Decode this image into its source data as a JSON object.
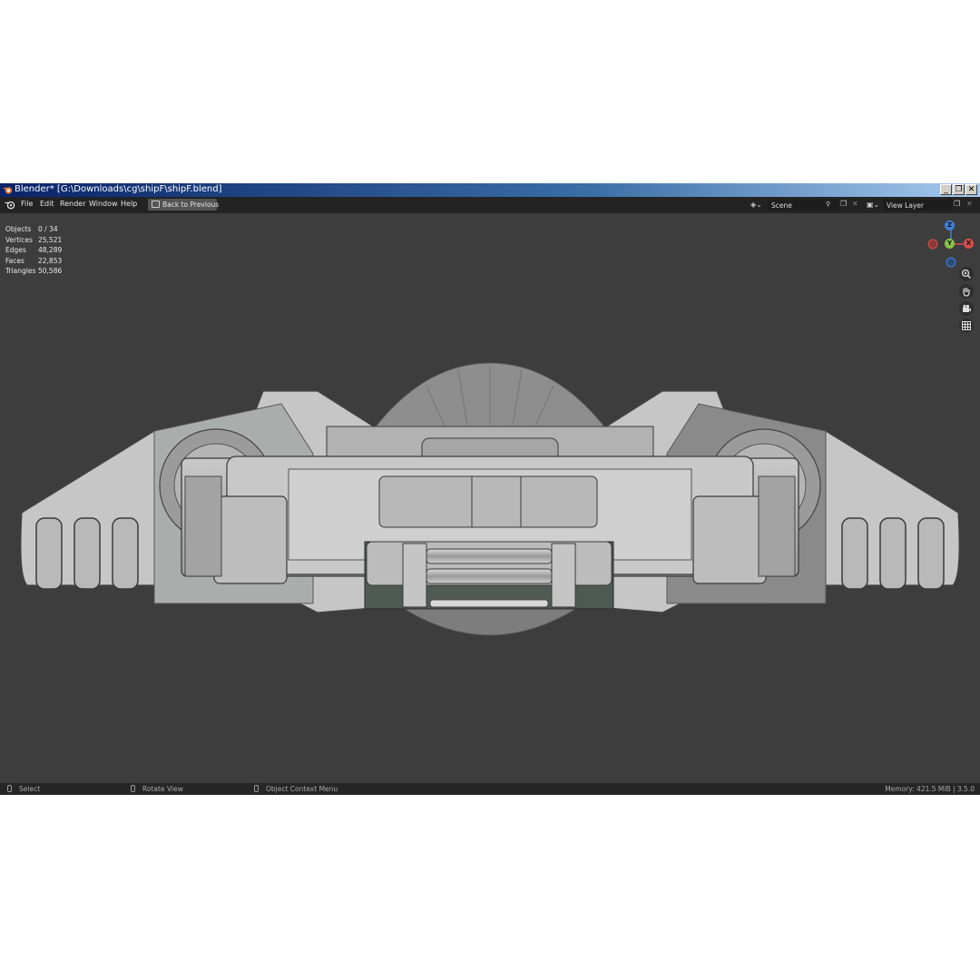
{
  "window": {
    "title": "Blender* [G:\\Downloads\\cg\\shipF\\shipF.blend]"
  },
  "menu": {
    "items": [
      "File",
      "Edit",
      "Render",
      "Window",
      "Help"
    ],
    "back_button": "Back to Previous"
  },
  "header": {
    "scene_label": "Scene",
    "view_layer_label": "View Layer"
  },
  "stats": {
    "rows": [
      {
        "label": "Objects",
        "value": "0 / 34"
      },
      {
        "label": "Vertices",
        "value": "25,521"
      },
      {
        "label": "Edges",
        "value": "48,289"
      },
      {
        "label": "Faces",
        "value": "22,853"
      },
      {
        "label": "Triangles",
        "value": "50,586"
      }
    ]
  },
  "gizmo": {
    "z": "Z",
    "y": "Y",
    "x": "X",
    "x_color": "#d74e4e",
    "y_color": "#8bc34a",
    "z_color": "#3f7fd6"
  },
  "nav_icons": [
    "zoom-icon",
    "hand-pan-icon",
    "camera-icon",
    "grid-icon"
  ],
  "statusbar": {
    "select": "Select",
    "rotate": "Rotate View",
    "context": "Object Context Menu",
    "memory": "Memory: 421.5 MiB | 3.5.0"
  }
}
